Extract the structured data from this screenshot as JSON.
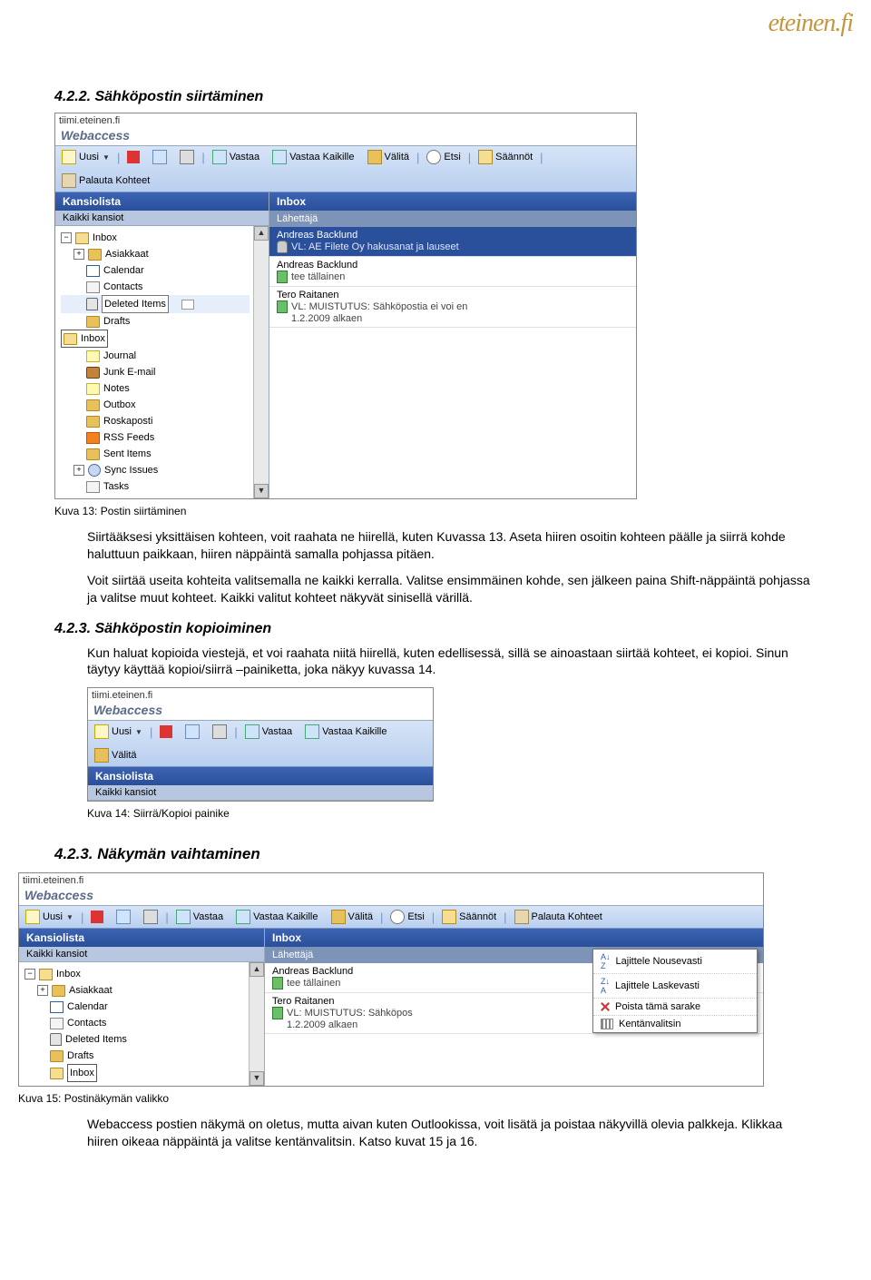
{
  "logo": "eteinen.fi",
  "section_422_title": "4.2.2. Sähköpostin siirtäminen",
  "kuva13": "Kuva 13: Postin siirtäminen",
  "para_422a": "Siirtääksesi yksittäisen kohteen, voit raahata ne hiirellä, kuten Kuvassa 13. Aseta hiiren osoitin kohteen päälle ja siirrä kohde haluttuun paikkaan, hiiren näppäintä samalla pohjassa pitäen.",
  "para_422b": "Voit siirtää useita kohteita valitsemalla ne kaikki kerralla. Valitse ensimmäinen kohde, sen jälkeen paina Shift-näppäintä pohjassa ja valitse muut kohteet. Kaikki valitut kohteet näkyvät sinisellä värillä.",
  "section_423_title": "4.2.3. Sähköpostin kopioiminen",
  "para_423": "Kun haluat kopioida viestejä, et voi raahata niitä hiirellä, kuten edellisessä, sillä se ainoastaan siirtää kohteet, ei kopioi. Sinun täytyy käyttää kopioi/siirrä –painiketta, joka näkyy kuvassa 14.",
  "kuva14": "Kuva 14: Siirrä/Kopioi painike",
  "section_423b_title": "4.2.3. Näkymän vaihtaminen",
  "kuva15": "Kuva 15: Postinäkymän valikko",
  "para_423b": "Webaccess postien näkymä on oletus, mutta aivan kuten Outlookissa, voit lisätä ja poistaa näkyvillä olevia palkkeja. Klikkaa hiiren oikeaa näppäintä ja valitse kentänvalitsin. Katso kuvat 15 ja 16.",
  "ui": {
    "url": "tiimi.eteinen.fi",
    "webaccess": "Webaccess",
    "toolbar": {
      "uusi": "Uusi",
      "vastaa": "Vastaa",
      "vastaa_kaikille": "Vastaa Kaikille",
      "valita": "Välitä",
      "etsi": "Etsi",
      "saannot": "Säännöt",
      "palauta": "Palauta Kohteet"
    },
    "kansiolista": "Kansiolista",
    "kaikki_kansiot": "Kaikki kansiot",
    "inbox_panel": "Inbox",
    "lahettaja": "Lähettäjä",
    "folders": {
      "inbox": "Inbox",
      "asiakkaat": "Asiakkaat",
      "calendar": "Calendar",
      "contacts": "Contacts",
      "deleted": "Deleted Items",
      "drafts": "Drafts",
      "inbox2": "Inbox",
      "journal": "Journal",
      "junk": "Junk E-mail",
      "notes": "Notes",
      "outbox": "Outbox",
      "roskaposti": "Roskaposti",
      "rss": "RSS Feeds",
      "sent": "Sent Items",
      "sync": "Sync Issues",
      "tasks": "Tasks"
    },
    "messages": {
      "m1_from": "Andreas Backlund",
      "m1_subj": "VL: AE Filete Oy hakusanat ja lauseet",
      "m2_from": "Andreas Backlund",
      "m2_subj": "tee tällainen",
      "m3_from": "Tero Raitanen",
      "m3_subj": "VL: MUISTUTUS: Sähköpostia ei voi en",
      "m3_subj_b": "VL: MUISTUTUS: Sähköpos",
      "m3_date": "1.2.2009 alkaen"
    },
    "ctx": {
      "asc": "Lajittele Nousevasti",
      "desc": "Lajittele Laskevasti",
      "remove": "Poista tämä sarake",
      "fields": "Kentänvalitsin"
    }
  }
}
